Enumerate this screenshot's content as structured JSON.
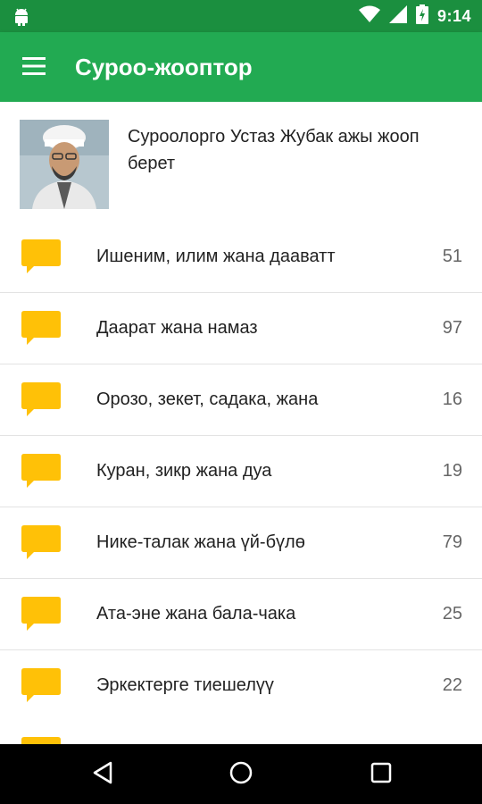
{
  "status_bar": {
    "time": "9:14"
  },
  "app_bar": {
    "title": "Суроо-жооптор"
  },
  "header": {
    "text": "Суроолорго Устаз Жубак ажы жооп берет"
  },
  "categories": [
    {
      "label": "Ишеним, илим жана дааватт",
      "count": "51"
    },
    {
      "label": "Даарат жана намаз",
      "count": "97"
    },
    {
      "label": "Орозо, зекет, садака, жана",
      "count": "16"
    },
    {
      "label": "Куран, зикр жана дуа",
      "count": "19"
    },
    {
      "label": "Нике-талак жана үй-бүлө",
      "count": "79"
    },
    {
      "label": "Ата-эне жана бала-чака",
      "count": "25"
    },
    {
      "label": "Эркектерге тиешелүү",
      "count": "22"
    }
  ],
  "colors": {
    "status_bar": "#1b8f3f",
    "app_bar": "#22aa52",
    "chat_icon": "#ffc107"
  },
  "icons": [
    "android-icon",
    "wifi-icon",
    "signal-icon",
    "battery-icon",
    "menu-icon",
    "chat-bubble-icon",
    "back-icon",
    "home-icon",
    "recents-icon"
  ]
}
